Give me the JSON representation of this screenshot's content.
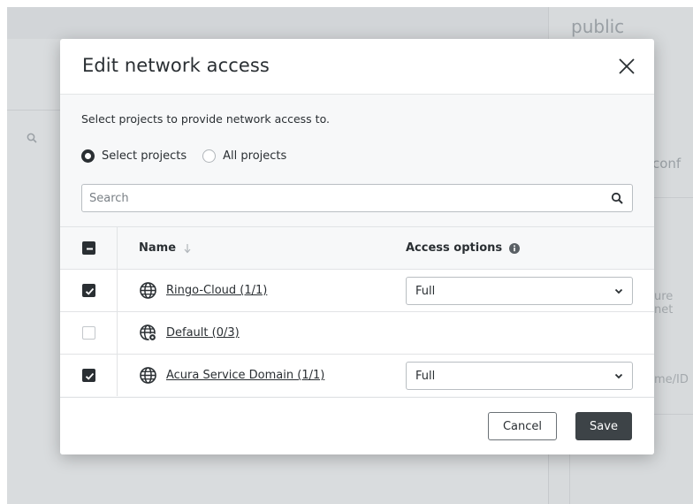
{
  "background": {
    "heading": "public",
    "right_fragments": [
      "conf",
      "ure net",
      "me/ID"
    ]
  },
  "modal": {
    "title": "Edit network access",
    "description": "Select projects to provide network access to.",
    "radio_options": [
      {
        "label": "Select projects",
        "checked": true
      },
      {
        "label": "All projects",
        "checked": false
      }
    ],
    "search": {
      "placeholder": "Search",
      "value": ""
    },
    "table": {
      "columns": {
        "name": "Name",
        "access": "Access options"
      },
      "header_checkbox": "indeterminate",
      "rows": [
        {
          "name": "Ringo-Cloud (1/1)",
          "checked": true,
          "icon": "globe-icon",
          "access": "Full"
        },
        {
          "name": "Default (0/3)",
          "checked": false,
          "icon": "globe-gear-icon",
          "access": null
        },
        {
          "name": "Acura Service Domain (1/1)",
          "checked": true,
          "icon": "globe-icon",
          "access": "Full"
        }
      ]
    },
    "buttons": {
      "cancel": "Cancel",
      "save": "Save"
    }
  },
  "colors": {
    "primary_dark": "#3d4347",
    "overlay": "#d9dcde",
    "text": "#2a2f33"
  }
}
